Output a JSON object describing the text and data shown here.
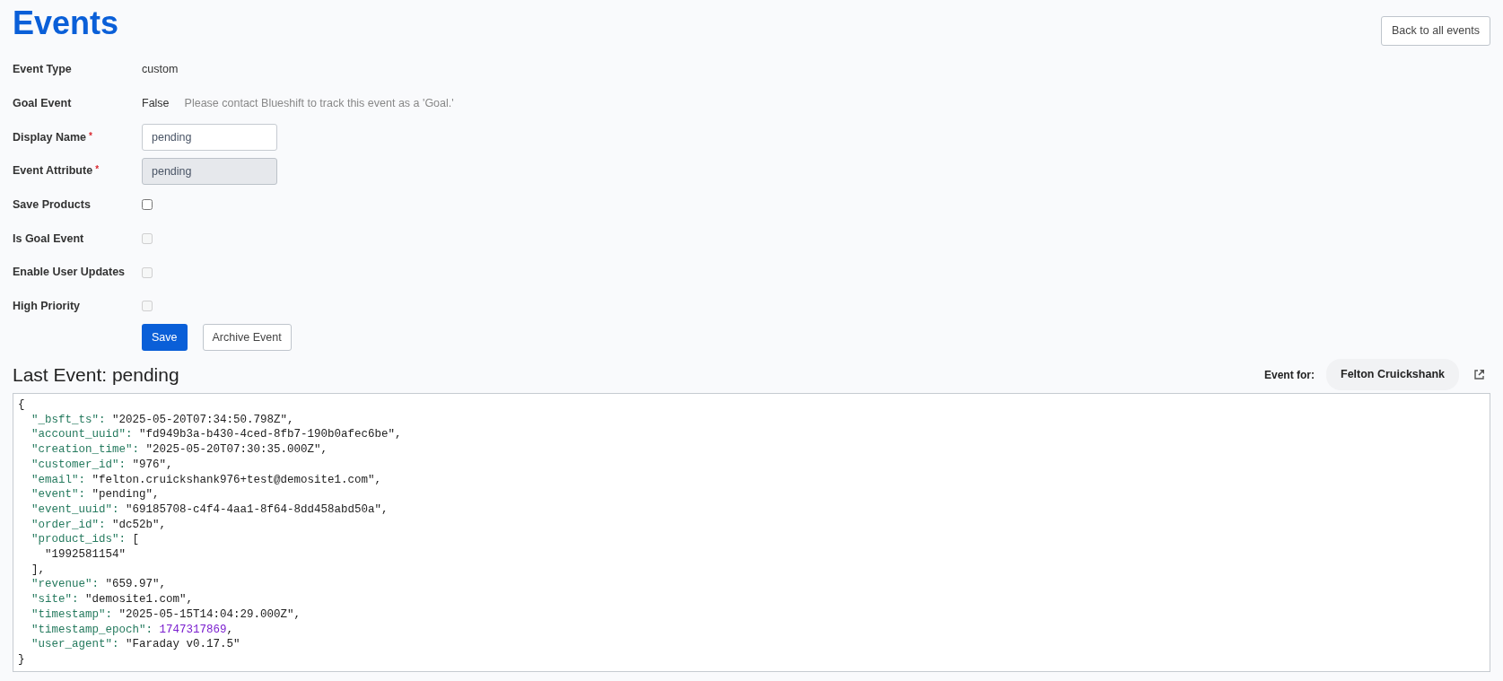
{
  "title": "Events",
  "back_button": "Back to all events",
  "fields": [
    {
      "kind": "text",
      "label": "Event Type",
      "value": "custom"
    },
    {
      "kind": "text",
      "label": "Goal Event",
      "value": "False",
      "note": "Please contact Blueshift to track this event as a 'Goal.'"
    },
    {
      "kind": "input",
      "label": "Display Name",
      "required_mark": "*",
      "value": "pending",
      "disabled": false
    },
    {
      "kind": "input",
      "label": "Event Attribute",
      "required_mark": "*",
      "value": "pending",
      "disabled": true
    },
    {
      "kind": "checkbox",
      "label": "Save Products",
      "checked": false,
      "disabled": false
    },
    {
      "kind": "checkbox",
      "label": "Is Goal Event",
      "checked": false,
      "disabled": true
    },
    {
      "kind": "checkbox",
      "label": "Enable User Updates",
      "checked": false,
      "disabled": true
    },
    {
      "kind": "checkbox",
      "label": "High Priority",
      "checked": false,
      "disabled": true
    }
  ],
  "actions": [
    {
      "label": "Save",
      "kind": "primary"
    },
    {
      "label": "Archive Event",
      "kind": "secondary"
    }
  ],
  "last_event": {
    "heading": "Last Event: pending",
    "event_for_label": "Event for:",
    "user": "Felton Cruickshank",
    "code": {
      "open": "{",
      "close": "}",
      "entries": [
        {
          "key": "\"_bsft_ts\":",
          "value": "\"2025-05-20T07:34:50.798Z\",",
          "kind": "string"
        },
        {
          "key": "\"account_uuid\":",
          "value": "\"fd949b3a-b430-4ced-8fb7-190b0afec6be\",",
          "kind": "string"
        },
        {
          "key": "\"creation_time\":",
          "value": "\"2025-05-20T07:30:35.000Z\",",
          "kind": "string"
        },
        {
          "key": "\"customer_id\":",
          "value": "\"976\",",
          "kind": "string"
        },
        {
          "key": "\"email\":",
          "value": "\"felton.cruickshank976+test@demosite1.com\",",
          "kind": "string"
        },
        {
          "key": "\"event\":",
          "value": "\"pending\",",
          "kind": "string"
        },
        {
          "key": "\"event_uuid\":",
          "value": "\"69185708-c4f4-4aa1-8f64-8dd458abd50a\",",
          "kind": "string"
        },
        {
          "key": "\"order_id\":",
          "value": "\"dc52b\",",
          "kind": "string"
        },
        {
          "key": "\"product_ids\":",
          "value": "[",
          "kind": "string",
          "children": [
            {
              "value": "\"1992581154\"",
              "kind": "string"
            }
          ],
          "close": "],"
        },
        {
          "key": "\"revenue\":",
          "value": "\"659.97\",",
          "kind": "string"
        },
        {
          "key": "\"site\":",
          "value": "\"demosite1.com\",",
          "kind": "string"
        },
        {
          "key": "\"timestamp\":",
          "value": "\"2025-05-15T14:04:29.000Z\",",
          "kind": "string"
        },
        {
          "key": "\"timestamp_epoch\":",
          "value": "1747317869",
          "suffix": ",",
          "kind": "number"
        },
        {
          "key": "\"user_agent\":",
          "value": "\"Faraday v0.17.5\"",
          "kind": "string"
        }
      ]
    }
  }
}
